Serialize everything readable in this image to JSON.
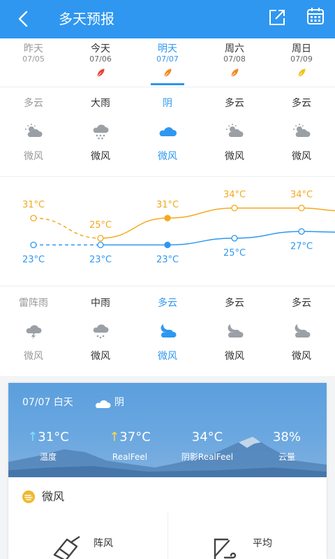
{
  "header": {
    "title": "多天预报",
    "back_icon": "back-arrow-icon",
    "share_icon": "share-icon",
    "calendar_icon": "calendar-icon",
    "bg_color": "#2f97f0"
  },
  "days": [
    {
      "name": "昨天",
      "date": "07/05",
      "state": "past"
    },
    {
      "name": "今天",
      "date": "07/06",
      "state": "normal",
      "leaf_color": "#e8443a"
    },
    {
      "name": "明天",
      "date": "07/07",
      "state": "active",
      "leaf_color": "#f08a24"
    },
    {
      "name": "周六",
      "date": "07/08",
      "state": "normal",
      "leaf_color": "#f08a24"
    },
    {
      "name": "周日",
      "date": "07/09",
      "state": "normal",
      "leaf_color": "#f0c31c"
    }
  ],
  "day_weather": [
    {
      "condition": "多云",
      "wind": "微风",
      "icon": "partly-cloudy-icon"
    },
    {
      "condition": "大雨",
      "wind": "微风",
      "icon": "heavy-rain-icon"
    },
    {
      "condition": "阴",
      "wind": "微风",
      "icon": "overcast-icon"
    },
    {
      "condition": "多云",
      "wind": "微风",
      "icon": "partly-cloudy-icon"
    },
    {
      "condition": "多云",
      "wind": "微风",
      "icon": "partly-cloudy-icon"
    }
  ],
  "chart_data": {
    "type": "line",
    "categories": [
      "07/05",
      "07/06",
      "07/07",
      "07/08",
      "07/09"
    ],
    "series": [
      {
        "values": [
          31,
          25,
          31,
          34,
          34
        ],
        "color": "#f3a920"
      },
      {
        "values": [
          23,
          23,
          23,
          25,
          27
        ],
        "color": "#2f97f0"
      }
    ],
    "high_labels": [
      "31°C",
      "25°C",
      "31°C",
      "34°C",
      "34°C"
    ],
    "low_labels": [
      "23°C",
      "23°C",
      "23°C",
      "25°C",
      "27°C"
    ]
  },
  "night_weather": [
    {
      "condition": "雷阵雨",
      "wind": "微风",
      "icon": "thunderstorm-icon"
    },
    {
      "condition": "中雨",
      "wind": "微风",
      "icon": "moderate-rain-icon"
    },
    {
      "condition": "多云",
      "wind": "微风",
      "icon": "cloudy-night-icon"
    },
    {
      "condition": "多云",
      "wind": "微风",
      "icon": "cloudy-night-icon"
    },
    {
      "condition": "多云",
      "wind": "微风",
      "icon": "cloudy-night-icon"
    }
  ],
  "detail": {
    "date_period": "07/07 白天",
    "condition": "阴",
    "stats": [
      {
        "value": "31°C",
        "label": "温度",
        "arrow": "↑",
        "arrow_color": "blue"
      },
      {
        "value": "37°C",
        "label": "RealFeel",
        "arrow": "↑",
        "arrow_color": "yellow"
      },
      {
        "value": "34°C",
        "label": "阴影RealFeel",
        "arrow": "",
        "arrow_color": ""
      },
      {
        "value": "38%",
        "label": "云量",
        "arrow": "",
        "arrow_color": ""
      }
    ],
    "wind_title": "微风",
    "gust_label": "阵风",
    "avg_label": "平均"
  }
}
